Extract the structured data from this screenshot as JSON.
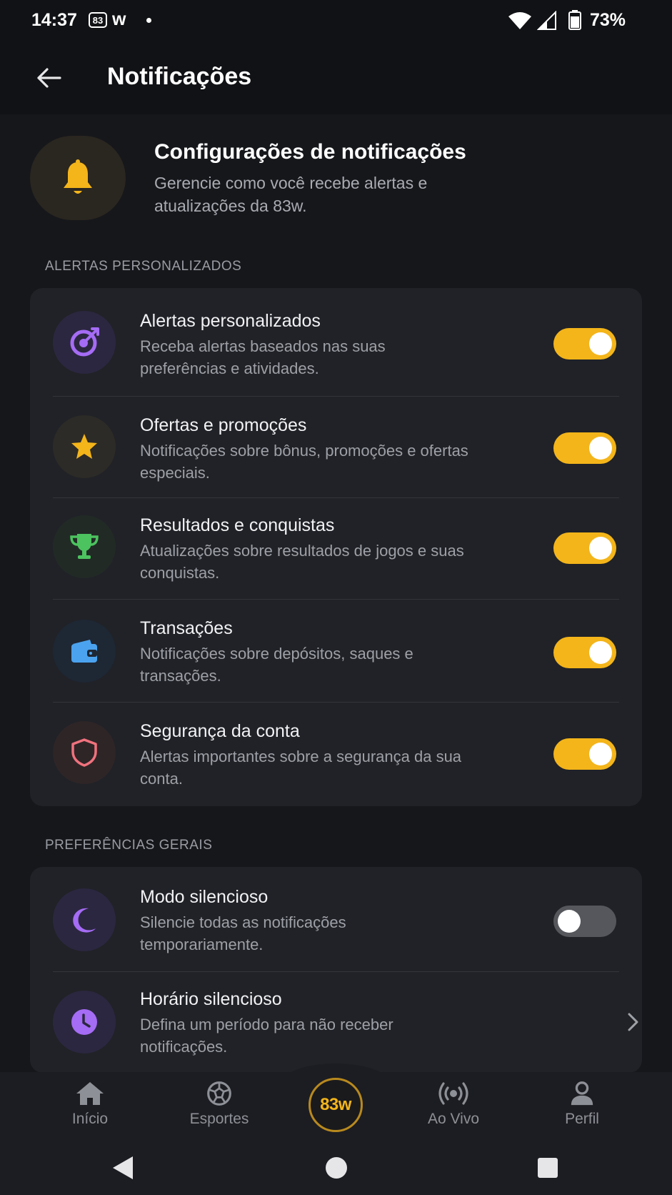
{
  "status_bar": {
    "time": "14:37",
    "app_badge": "83",
    "app_letter": "w",
    "battery": "73%"
  },
  "app_bar": {
    "title": "Notificações"
  },
  "hero": {
    "title": "Configurações de notificações",
    "subtitle": "Gerencie como você recebe alertas e atualizações da 83w."
  },
  "sections": {
    "alerts_label": "ALERTAS PERSONALIZADOS",
    "general_label": "PREFERÊNCIAS GERAIS"
  },
  "alert_rows": [
    {
      "title": "Alertas personalizados",
      "subtitle": "Receba alertas baseados nas suas preferências e atividades.",
      "icon": "target-icon",
      "enabled": true
    },
    {
      "title": "Ofertas e promoções",
      "subtitle": "Notificações sobre bônus, promoções e ofertas especiais.",
      "icon": "star-icon",
      "enabled": true
    },
    {
      "title": "Resultados e conquistas",
      "subtitle": "Atualizações sobre resultados de jogos e suas conquistas.",
      "icon": "trophy-icon",
      "enabled": true
    },
    {
      "title": "Transações",
      "subtitle": "Notificações sobre depósitos, saques e transações.",
      "icon": "wallet-icon",
      "enabled": true
    },
    {
      "title": "Segurança da conta",
      "subtitle": "Alertas importantes sobre a segurança da sua conta.",
      "icon": "shield-icon",
      "enabled": true
    }
  ],
  "general_rows": [
    {
      "title": "Modo silencioso",
      "subtitle": "Silencie todas as notificações temporariamente.",
      "icon": "moon-icon",
      "enabled": false
    },
    {
      "title": "Horário silencioso",
      "subtitle": "Defina um período para não receber notificações.",
      "icon": "clock-icon"
    }
  ],
  "bottom_nav": {
    "home": "Início",
    "sports": "Esportes",
    "center": "83w",
    "live": "Ao Vivo",
    "profile": "Perfil"
  },
  "colors": {
    "accent": "#f4b51a",
    "background": "#16171b",
    "card": "#202227"
  }
}
